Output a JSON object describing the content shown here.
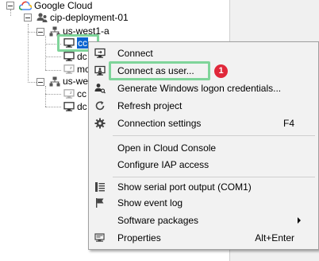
{
  "tree": {
    "root": "Google Cloud",
    "project": "cip-deployment-01",
    "zone1": {
      "name": "us-west1-a",
      "instances": [
        "cc",
        "dc",
        "mc"
      ]
    },
    "zone2": {
      "name": "us-wes",
      "instances": [
        "cc",
        "dc"
      ]
    }
  },
  "context_menu": {
    "items": [
      {
        "label": "Connect",
        "icon": "remote-desktop-icon"
      },
      {
        "label": "Connect as user...",
        "icon": "remote-desktop-user-icon"
      },
      {
        "label": "Generate Windows logon credentials...",
        "icon": "person-key-icon"
      },
      {
        "label": "Refresh project",
        "icon": "refresh-icon"
      },
      {
        "label": "Connection settings",
        "icon": "gear-icon",
        "shortcut": "F4"
      },
      {
        "label": "Open in Cloud Console"
      },
      {
        "label": "Configure IAP access"
      },
      {
        "label": "Show serial port output (COM1)",
        "icon": "serial-log-icon"
      },
      {
        "label": "Show event log",
        "icon": "flag-icon"
      },
      {
        "label": "Software packages",
        "submenu": true
      },
      {
        "label": "Properties",
        "icon": "properties-icon",
        "shortcut": "Alt+Enter"
      }
    ]
  },
  "annotation": {
    "badge": "1"
  },
  "colors": {
    "highlight_green": "#7fd49a",
    "selection_blue": "#0a64d0",
    "badge_red": "#e0283a",
    "menu_bg": "#f2f2f2"
  }
}
